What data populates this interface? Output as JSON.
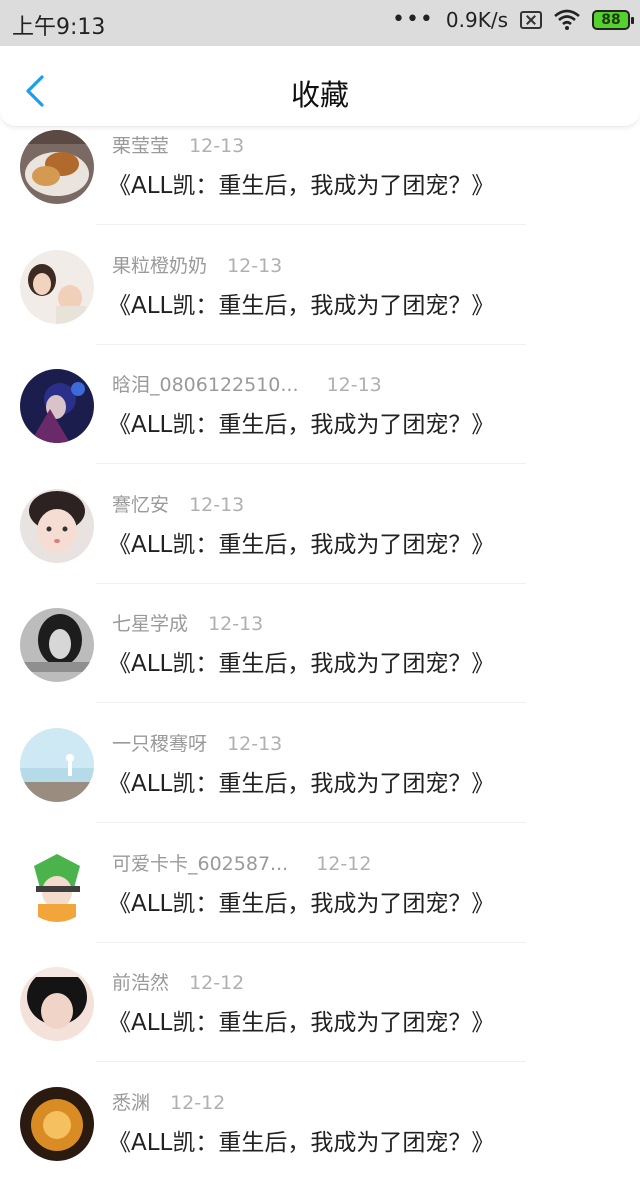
{
  "status_bar": {
    "time": "上午9:13",
    "dots": "•••",
    "speed": "0.9K/s",
    "battery": "88"
  },
  "header": {
    "title": "收藏"
  },
  "items": [
    {
      "user": "栗莹莹",
      "date": "12-13",
      "text": "《ALL凯：重生后，我成为了团宠？》"
    },
    {
      "user": "果粒橙奶奶",
      "date": "12-13",
      "text": "《ALL凯：重生后，我成为了团宠？》"
    },
    {
      "user": "晗泪_0806122510...",
      "date": "12-13",
      "text": "《ALL凯：重生后，我成为了团宠？》"
    },
    {
      "user": "謇忆安",
      "date": "12-13",
      "text": "《ALL凯：重生后，我成为了团宠？》"
    },
    {
      "user": "七星学成",
      "date": "12-13",
      "text": "《ALL凯：重生后，我成为了团宠？》"
    },
    {
      "user": "一只稷骞呀",
      "date": "12-13",
      "text": "《ALL凯：重生后，我成为了团宠？》"
    },
    {
      "user": "可爱卡卡_602587...",
      "date": "12-12",
      "text": "《ALL凯：重生后，我成为了团宠？》"
    },
    {
      "user": "前浩然",
      "date": "12-12",
      "text": "《ALL凯：重生后，我成为了团宠？》"
    },
    {
      "user": "悉渊",
      "date": "12-12",
      "text": "《ALL凯：重生后，我成为了团宠？》"
    }
  ]
}
